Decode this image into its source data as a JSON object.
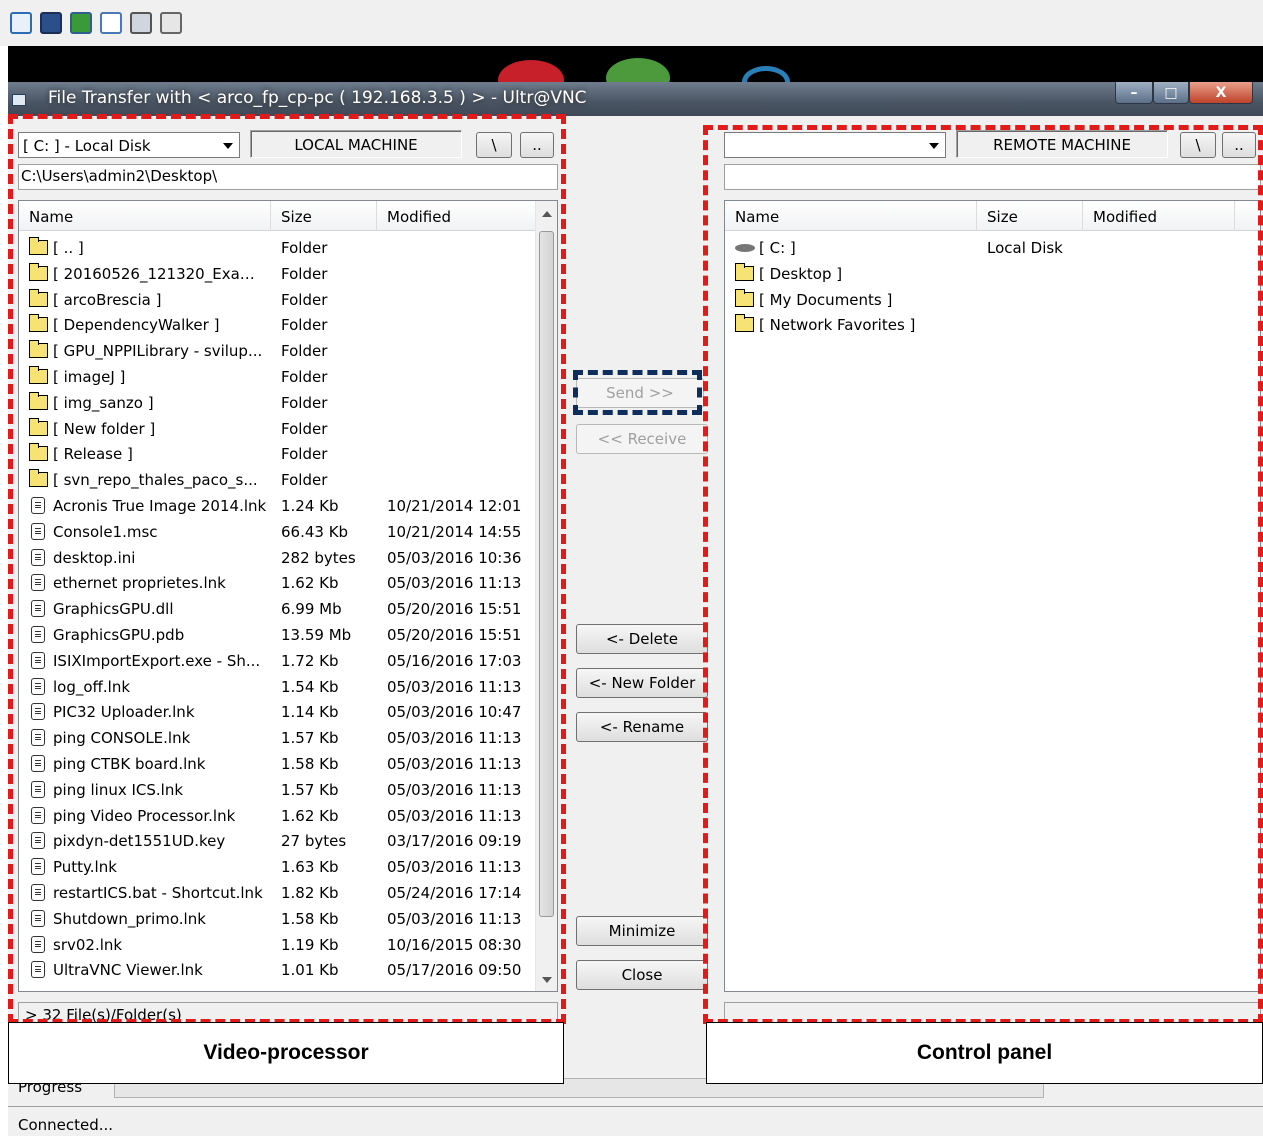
{
  "toolbar": {
    "icons": [
      "fullscreen-icon",
      "monitor-icon",
      "refresh-transfer-icon",
      "new-document-icon",
      "window-icon",
      "chat-icon"
    ]
  },
  "window": {
    "title": "File Transfer with < arco_fp_cp-pc ( 192.168.3.5 ) >  -  Ultr@VNC",
    "minimize_glyph": "–",
    "maximize_glyph": "□",
    "close_glyph": "X"
  },
  "local": {
    "drive_selected": "[ C: ] - Local Disk",
    "machine_label": "LOCAL MACHINE",
    "root_button": "\\",
    "up_button": "..",
    "path": "C:\\Users\\admin2\\Desktop\\",
    "columns": [
      "Name",
      "Size",
      "Modified"
    ],
    "rows": [
      {
        "icon": "folder",
        "name": "[ .. ]",
        "size": "Folder",
        "modified": ""
      },
      {
        "icon": "folder",
        "name": "[ 20160526_121320_Exam...",
        "size": "Folder",
        "modified": ""
      },
      {
        "icon": "folder",
        "name": "[ arcoBrescia ]",
        "size": "Folder",
        "modified": ""
      },
      {
        "icon": "folder",
        "name": "[ DependencyWalker ]",
        "size": "Folder",
        "modified": ""
      },
      {
        "icon": "folder",
        "name": "[ GPU_NPPILibrary - svilup...",
        "size": "Folder",
        "modified": ""
      },
      {
        "icon": "folder",
        "name": "[ imageJ ]",
        "size": "Folder",
        "modified": ""
      },
      {
        "icon": "folder",
        "name": "[ img_sanzo ]",
        "size": "Folder",
        "modified": ""
      },
      {
        "icon": "folder",
        "name": "[ New folder ]",
        "size": "Folder",
        "modified": ""
      },
      {
        "icon": "folder",
        "name": "[ Release ]",
        "size": "Folder",
        "modified": ""
      },
      {
        "icon": "folder",
        "name": "[ svn_repo_thales_paco_s...",
        "size": "Folder",
        "modified": ""
      },
      {
        "icon": "file",
        "name": "Acronis True Image 2014.lnk",
        "size": "1.24 Kb",
        "modified": "10/21/2014 12:01"
      },
      {
        "icon": "file",
        "name": "Console1.msc",
        "size": "66.43 Kb",
        "modified": "10/21/2014 14:55"
      },
      {
        "icon": "file",
        "name": "desktop.ini",
        "size": "282 bytes",
        "modified": "05/03/2016 10:36"
      },
      {
        "icon": "file",
        "name": "ethernet proprietes.lnk",
        "size": "1.62 Kb",
        "modified": "05/03/2016 11:13"
      },
      {
        "icon": "file",
        "name": "GraphicsGPU.dll",
        "size": "6.99 Mb",
        "modified": "05/20/2016 15:51"
      },
      {
        "icon": "file",
        "name": "GraphicsGPU.pdb",
        "size": "13.59 Mb",
        "modified": "05/20/2016 15:51"
      },
      {
        "icon": "file",
        "name": "ISIXImportExport.exe - Sh...",
        "size": "1.72 Kb",
        "modified": "05/16/2016 17:03"
      },
      {
        "icon": "file",
        "name": "log_off.lnk",
        "size": "1.54 Kb",
        "modified": "05/03/2016 11:13"
      },
      {
        "icon": "file",
        "name": "PIC32 Uploader.lnk",
        "size": "1.14 Kb",
        "modified": "05/03/2016 10:47"
      },
      {
        "icon": "file",
        "name": "ping CONSOLE.lnk",
        "size": "1.57 Kb",
        "modified": "05/03/2016 11:13"
      },
      {
        "icon": "file",
        "name": "ping CTBK board.lnk",
        "size": "1.58 Kb",
        "modified": "05/03/2016 11:13"
      },
      {
        "icon": "file",
        "name": "ping linux ICS.lnk",
        "size": "1.57 Kb",
        "modified": "05/03/2016 11:13"
      },
      {
        "icon": "file",
        "name": "ping Video Processor.lnk",
        "size": "1.62 Kb",
        "modified": "05/03/2016 11:13"
      },
      {
        "icon": "file",
        "name": "pixdyn-det1551UD.key",
        "size": "27 bytes",
        "modified": "03/17/2016 09:19"
      },
      {
        "icon": "file",
        "name": "Putty.lnk",
        "size": "1.63 Kb",
        "modified": "05/03/2016 11:13"
      },
      {
        "icon": "file",
        "name": "restartICS.bat - Shortcut.lnk",
        "size": "1.82 Kb",
        "modified": "05/24/2016 17:14"
      },
      {
        "icon": "file",
        "name": "Shutdown_primo.lnk",
        "size": "1.58 Kb",
        "modified": "05/03/2016 11:13"
      },
      {
        "icon": "file",
        "name": "srv02.lnk",
        "size": "1.19 Kb",
        "modified": "10/16/2015 08:30"
      },
      {
        "icon": "file",
        "name": "UltraVNC Viewer.lnk",
        "size": "1.01 Kb",
        "modified": "05/17/2016 09:50"
      }
    ],
    "status": "> 32 File(s)/Folder(s)"
  },
  "remote": {
    "drive_selected": "",
    "machine_label": "REMOTE MACHINE",
    "root_button": "\\",
    "up_button": "..",
    "path": "",
    "columns": [
      "Name",
      "Size",
      "Modified"
    ],
    "rows": [
      {
        "icon": "drive",
        "name": "[ C: ]",
        "size": "Local Disk",
        "modified": ""
      },
      {
        "icon": "folder",
        "name": "[ Desktop ]",
        "size": "",
        "modified": ""
      },
      {
        "icon": "folder",
        "name": "[ My Documents ]",
        "size": "",
        "modified": ""
      },
      {
        "icon": "folder",
        "name": "[ Network Favorites ]",
        "size": "",
        "modified": ""
      }
    ],
    "status": ""
  },
  "actions": {
    "send": "Send >>",
    "receive": "<< Receive",
    "delete": "<- Delete",
    "new_folder": "<- New Folder",
    "rename": "<- Rename",
    "minimize": "Minimize",
    "close": "Close"
  },
  "progress": {
    "label": "Progress",
    "value": 0
  },
  "status_bar": {
    "text": "Connected..."
  },
  "annotations": {
    "left_caption": "Video-processor",
    "right_caption": "Control panel",
    "highlight_color": "#e21a1a",
    "send_highlight_color": "#0d2d5c"
  }
}
